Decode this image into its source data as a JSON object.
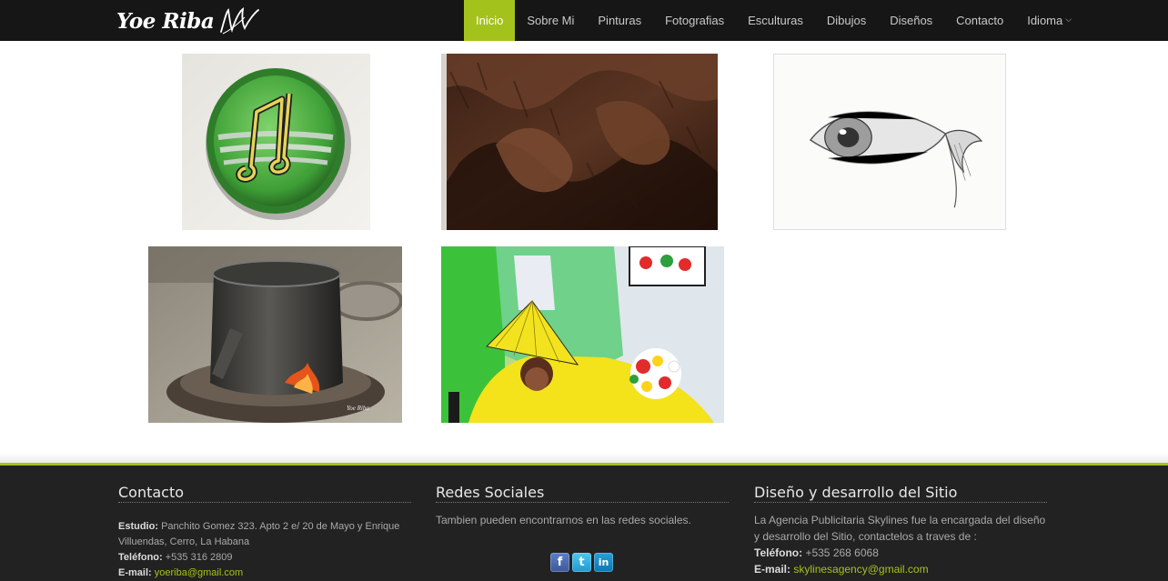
{
  "brand": {
    "name": "Yoe Riba"
  },
  "nav": {
    "items": [
      {
        "label": "Inicio",
        "active": true
      },
      {
        "label": "Sobre Mi"
      },
      {
        "label": "Pinturas"
      },
      {
        "label": "Fotografias"
      },
      {
        "label": "Esculturas"
      },
      {
        "label": "Dibujos"
      },
      {
        "label": "Diseños"
      },
      {
        "label": "Contacto"
      },
      {
        "label": "Idioma",
        "dropdown": true
      }
    ]
  },
  "gallery": [
    {
      "subject": "green painted plate with musical notes"
    },
    {
      "subject": "carved wood sculpture detail"
    },
    {
      "subject": "pencil drawing of an eye"
    },
    {
      "subject": "old metal pot on a stove",
      "watermark": "Yoe Riba"
    },
    {
      "subject": "colorful design with dancer, fan and flowers"
    }
  ],
  "footer": {
    "contact": {
      "title": "Contacto",
      "studio_label": "Estudio:",
      "studio_value": "Panchito Gomez 323. Apto 2 e/ 20 de Mayo y Enrique Villuendas, Cerro, La Habana",
      "phone_label": "Teléfono:",
      "phone_value": "+535 316 2809",
      "email_label": "E-mail:",
      "email_value": "yoeriba@gmail.com"
    },
    "social": {
      "title": "Redes Sociales",
      "text": "Tambien pueden encontrarnos en las redes sociales.",
      "icons": [
        "facebook-icon",
        "twitter-icon",
        "linkedin-icon"
      ]
    },
    "credits": {
      "title": "Diseño y desarrollo del Sitio",
      "text": "La Agencia Publicitaria Skylines fue la encargada del diseño y desarrollo del Sitio, contactelos a traves de :",
      "phone_label": "Teléfono:",
      "phone_value": "+535 268 6068",
      "email_label": "E-mail:",
      "email_value": "skylinesagency@gmail.com"
    }
  },
  "colors": {
    "accent": "#a4c21c",
    "navbar": "#161616",
    "footer": "#222222"
  }
}
